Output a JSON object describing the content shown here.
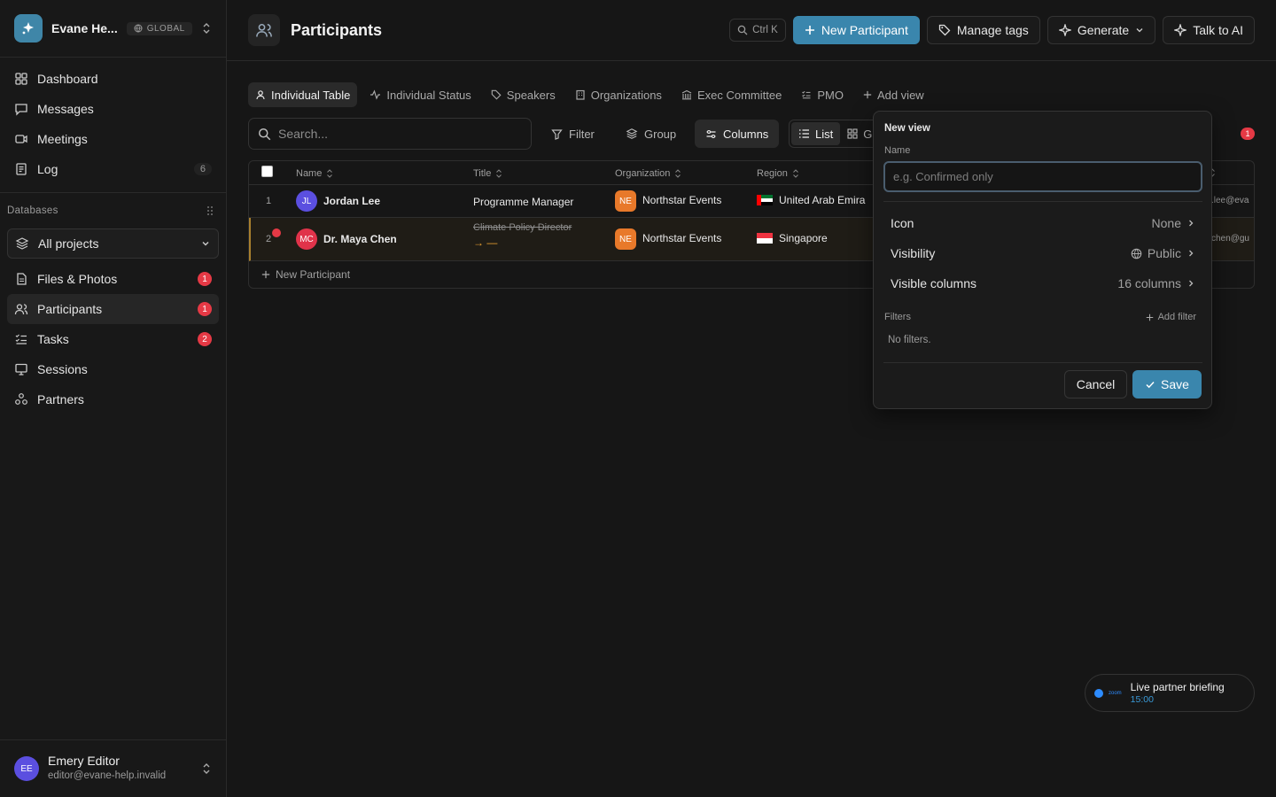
{
  "workspace": {
    "name": "Evane He...",
    "scope": "GLOBAL"
  },
  "nav": [
    {
      "label": "Dashboard",
      "icon": "dashboard-icon"
    },
    {
      "label": "Messages",
      "icon": "message-icon"
    },
    {
      "label": "Meetings",
      "icon": "video-icon"
    },
    {
      "label": "Log",
      "icon": "log-icon",
      "count": "6"
    }
  ],
  "databases": {
    "heading": "Databases",
    "project": "All projects",
    "items": [
      {
        "label": "Files & Photos",
        "badge": "1"
      },
      {
        "label": "Participants",
        "badge": "1"
      },
      {
        "label": "Tasks",
        "badge": "2"
      },
      {
        "label": "Sessions",
        "badge": ""
      },
      {
        "label": "Partners",
        "badge": ""
      }
    ]
  },
  "user": {
    "initials": "EE",
    "name": "Emery Editor",
    "email": "editor@evane-help.invalid"
  },
  "header": {
    "title": "Participants",
    "shortcut": "Ctrl K",
    "new_participant": "New Participant",
    "manage_tags": "Manage tags",
    "generate": "Generate",
    "talk_to_ai": "Talk to AI"
  },
  "tabs": [
    "Individual Table",
    "Individual Status",
    "Speakers",
    "Organizations",
    "Exec Committee",
    "PMO",
    "Add view"
  ],
  "toolbar": {
    "search_placeholder": "Search...",
    "filter": "Filter",
    "group": "Group",
    "columns": "Columns",
    "list": "List",
    "grid": "G",
    "notification_count": "1"
  },
  "table": {
    "columns": [
      "Name",
      "Title",
      "Organization",
      "Region"
    ],
    "rows": [
      {
        "num": "1",
        "initials": "JL",
        "name": "Jordan Lee",
        "title": "Programme Manager",
        "org_initials": "NE",
        "org": "Northstar Events",
        "region": "United Arab Emira",
        "email": ".lee@eva"
      },
      {
        "num": "2",
        "initials": "MC",
        "name": "Dr. Maya Chen",
        "title_old": "Climate Policy Director",
        "title_new": "→ —",
        "org_initials": "NE",
        "org": "Northstar Events",
        "region": "Singapore",
        "email": "chen@gu"
      }
    ],
    "new_row": "New Participant"
  },
  "popover": {
    "title": "New view",
    "name_label": "Name",
    "name_placeholder": "e.g. Confirmed only",
    "icon_label": "Icon",
    "icon_value": "None",
    "visibility_label": "Visibility",
    "visibility_value": "Public",
    "columns_label": "Visible columns",
    "columns_value": "16 columns",
    "filters_label": "Filters",
    "add_filter": "Add filter",
    "no_filters": "No filters.",
    "cancel": "Cancel",
    "save": "Save"
  },
  "meeting": {
    "title": "Live partner briefing",
    "time": "15:00",
    "provider": "zoom"
  },
  "colors": {
    "accent": "#3a86ad",
    "badge": "#e53945",
    "org": "#e8792a",
    "avatar_jl": "#5b4fe0",
    "avatar_mc": "#e0334a"
  }
}
